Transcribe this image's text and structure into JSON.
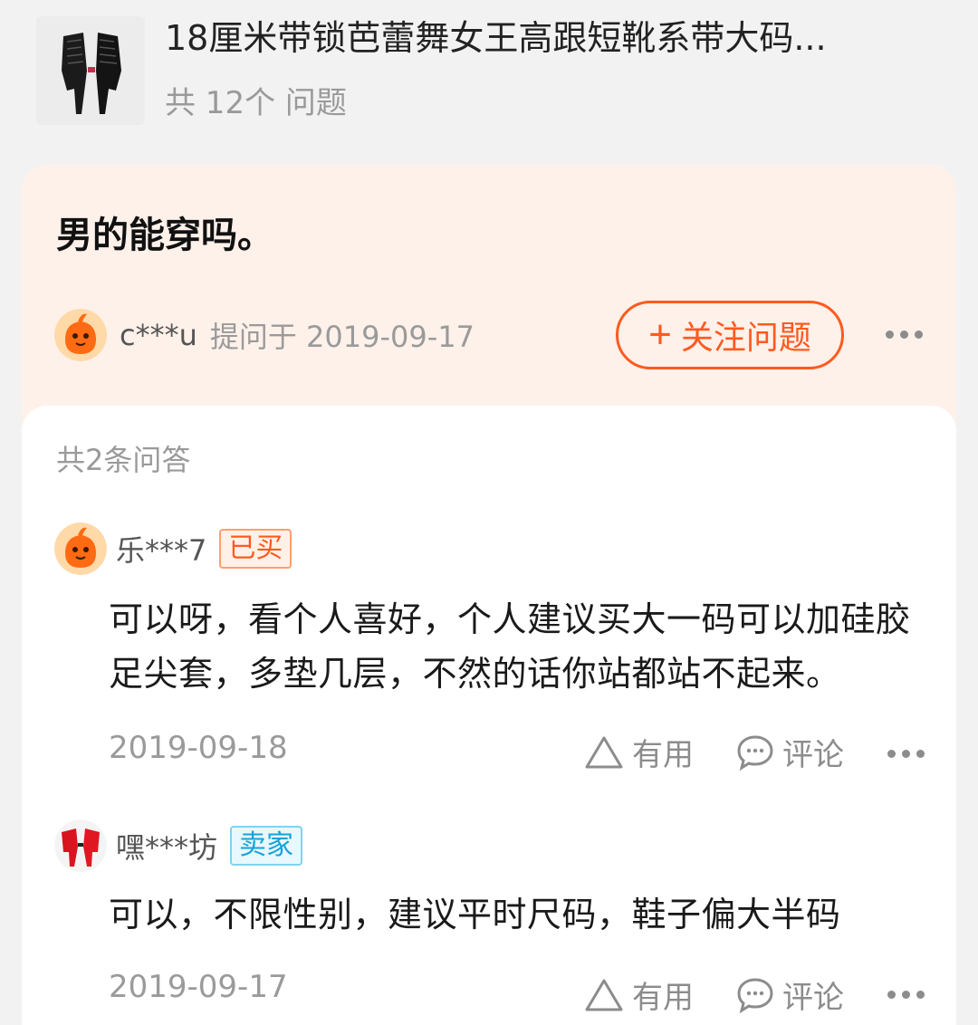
{
  "product": {
    "title": "18厘米带锁芭蕾舞女王高跟短靴系带大码...",
    "question_count": "共 12个 问题"
  },
  "question": {
    "text": "男的能穿吗。",
    "asker": "c***u",
    "asked_meta": "提问于 2019-09-17",
    "follow_label": "关注问题",
    "follow_plus": "+"
  },
  "answers": {
    "count_label": "共2条问答",
    "items": [
      {
        "user": "乐***7",
        "badge": "已买",
        "text": "可以呀，看个人喜好，个人建议买大一码可以加硅胶足尖套，多垫几层，不然的话你站都站不起来。",
        "date": "2019-09-18",
        "useful_label": "有用",
        "comment_label": "评论"
      },
      {
        "user": "嘿***坊",
        "badge": "卖家",
        "text": "可以，不限性别，建议平时尺码，鞋子偏大半码",
        "date": "2019-09-17",
        "useful_label": "有用",
        "comment_label": "评论"
      }
    ]
  },
  "colors": {
    "accent": "#ff5a1f",
    "seller": "#15a3d9",
    "question_bg": "#fdf1ea"
  }
}
